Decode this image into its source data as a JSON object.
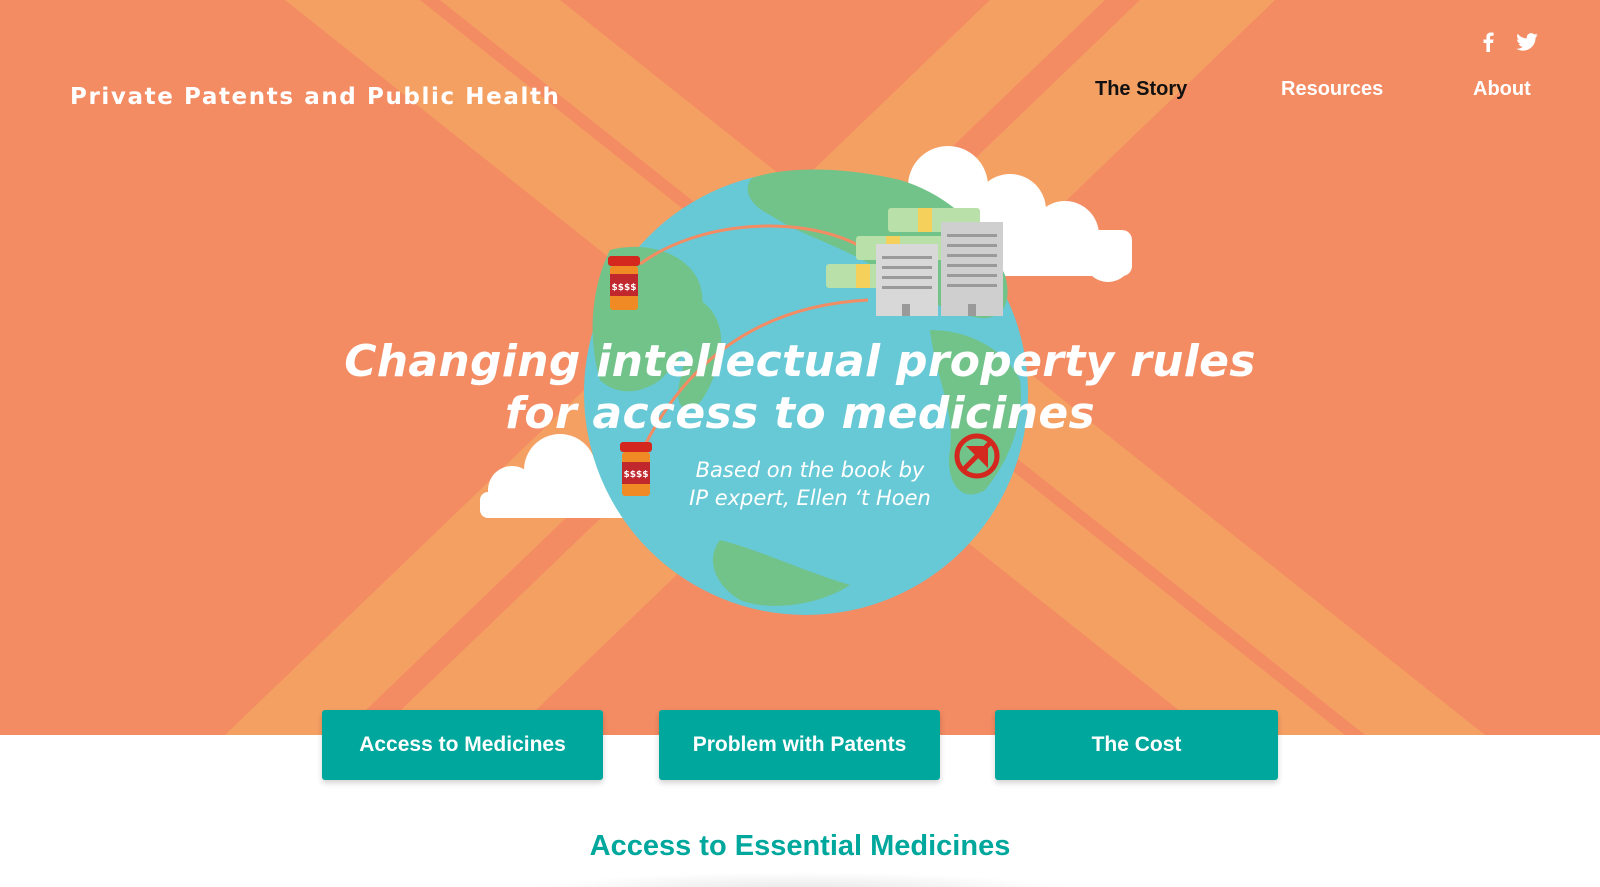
{
  "header": {
    "site_title": "Private Patents and Public Health",
    "nav": [
      {
        "label": "The Story",
        "active": true
      },
      {
        "label": "Resources",
        "active": false
      },
      {
        "label": "About",
        "active": false
      }
    ],
    "social": [
      {
        "icon": "facebook-icon"
      },
      {
        "icon": "twitter-icon"
      }
    ]
  },
  "hero": {
    "headline_line1": "Changing intellectual property rules",
    "headline_line2": "for access to medicines",
    "subhead_line1": "Based on the book by",
    "subhead_line2": "IP expert, Ellen ‘t Hoen",
    "pill_label": "$$$$",
    "colors": {
      "background": "#f38b63",
      "stripe": "#f5a063",
      "ocean": "#67c8d6",
      "land": "#72c38a"
    }
  },
  "buttons": [
    {
      "label": "Access to Medicines"
    },
    {
      "label": "Problem with Patents"
    },
    {
      "label": "The Cost"
    }
  ],
  "section": {
    "title": "Access to Essential Medicines"
  },
  "colors": {
    "accent": "#00a79c",
    "white": "#ffffff"
  }
}
